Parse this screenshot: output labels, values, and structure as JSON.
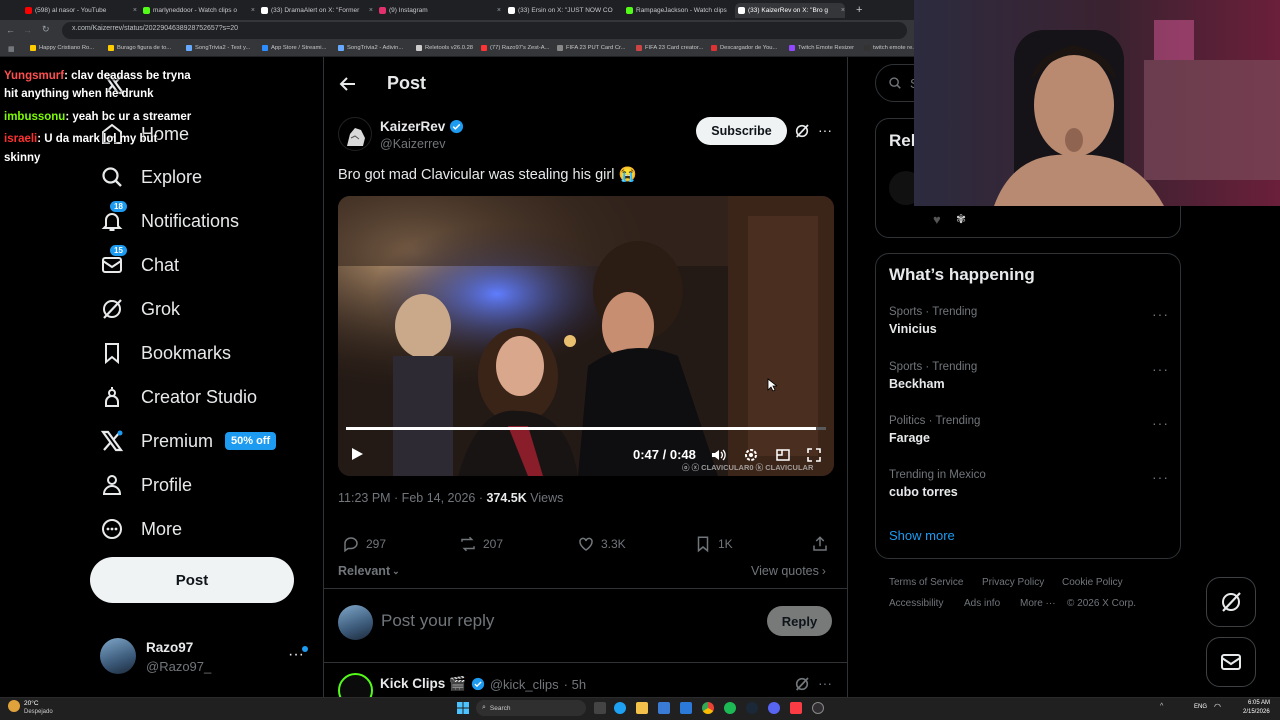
{
  "browser": {
    "tabs": [
      {
        "title": "(598) al nasor - YouTube",
        "color": "#ff0000"
      },
      {
        "title": "marlyneddoor - Watch clips o",
        "color": "#53fc18"
      },
      {
        "title": "(33) DramaAlert on X: \"Former",
        "color": "#ffffff"
      },
      {
        "title": "(9) Instagram",
        "color": "#e1306c"
      },
      {
        "title": "(33) Ersin on X: \"JUST NOW CO",
        "color": "#ffffff"
      },
      {
        "title": "RampageJackson - Watch clips",
        "color": "#53fc18"
      },
      {
        "title": "(33) KaizerRev on X: \"Bro g",
        "color": "#ffffff"
      }
    ],
    "url": "x.com/Kaizerrev/status/2022904638928752657?s=20",
    "bookmarks": [
      "Happy Cristiano Ro...",
      "Burago figura de to...",
      "SongTrivia2 - Test y...",
      "App Store / Streami...",
      "SongTrivia2 - Adivin...",
      "Reletools v26.0.28",
      "(77) Razo97's Zest-A...",
      "FIFA 23 PUT Card Cr...",
      "FIFA 23 Card creator...",
      "Descargador de You...",
      "Twitch Emote Resizer",
      "twitch emote re..."
    ]
  },
  "chat": [
    {
      "user": "Yungsmurf",
      "user_color": "#ff4f4f",
      "text": ": clav deadass be tryna"
    },
    {
      "user": "",
      "user_color": "#ffffff",
      "text": "hit anything when he drunk"
    },
    {
      "user": "imbussonu",
      "user_color": "#7cfc00",
      "text": ": yeah bc ur a streamer"
    },
    {
      "user": "israeli",
      "user_color": "#ff3030",
      "text": ": U da mark lol my but"
    },
    {
      "user": "",
      "user_color": "#ffffff",
      "text": "skinny"
    }
  ],
  "nav": {
    "home": "Home",
    "explore": "Explore",
    "notifications": "Notifications",
    "notifications_count": "18",
    "chat": "Chat",
    "chat_count": "15",
    "grok": "Grok",
    "bookmarks": "Bookmarks",
    "creator_studio": "Creator Studio",
    "premium": "Premium",
    "premium_badge": "50% off",
    "profile": "Profile",
    "more": "More",
    "post_button": "Post",
    "account_name": "Razo97",
    "account_handle": "@Razo97_"
  },
  "post": {
    "header_title": "Post",
    "author_name": "KaizerRev",
    "author_handle": "@Kaizerrev",
    "subscribe_label": "Subscribe",
    "text": "Bro got mad Clavicular was stealing his girl 😭",
    "video_time": "0:47 / 0:48",
    "video_progress": 0.979,
    "video_watermark": "ⓞ ⓧ CLAVICULAR0 ⓚ CLAVICULAR",
    "timestamp": "11:23 PM · Feb 14, 2026 · ",
    "views_count": "374.5K",
    "views_label": " Views",
    "replies": "297",
    "reposts": "207",
    "likes": "3.3K",
    "bookmarks": "1K",
    "sort_label": "Relevant",
    "view_quotes": "View quotes",
    "reply_placeholder": "Post your reply",
    "reply_button": "Reply"
  },
  "next_post": {
    "author_name": "Kick Clips 🎬",
    "author_handle": "@kick_clips",
    "time": "· 5h"
  },
  "sidebar": {
    "search_placeholder": "Se",
    "relevant_title": "Rel",
    "whats_happening_title": "What’s happening",
    "trends": [
      {
        "category": "Sports · Trending",
        "name": "Vinicius"
      },
      {
        "category": "Sports · Trending",
        "name": "Beckham"
      },
      {
        "category": "Politics · Trending",
        "name": "Farage"
      },
      {
        "category": "Trending in Mexico",
        "name": "cubo torres"
      }
    ],
    "show_more": "Show more",
    "footer": [
      "Terms of Service",
      "Privacy Policy",
      "Cookie Policy",
      "Accessibility",
      "Ads info",
      "More ···",
      "© 2026 X Corp."
    ]
  },
  "taskbar": {
    "weather_temp": "20°C",
    "weather_text": "Despejado",
    "search_label": "Search",
    "language": "ENG",
    "time": "6:05 AM",
    "date": "2/15/2026"
  },
  "colors": {
    "accent": "#1d9bf0",
    "background": "#000000",
    "border": "#2f3336",
    "muted": "#71767b"
  }
}
